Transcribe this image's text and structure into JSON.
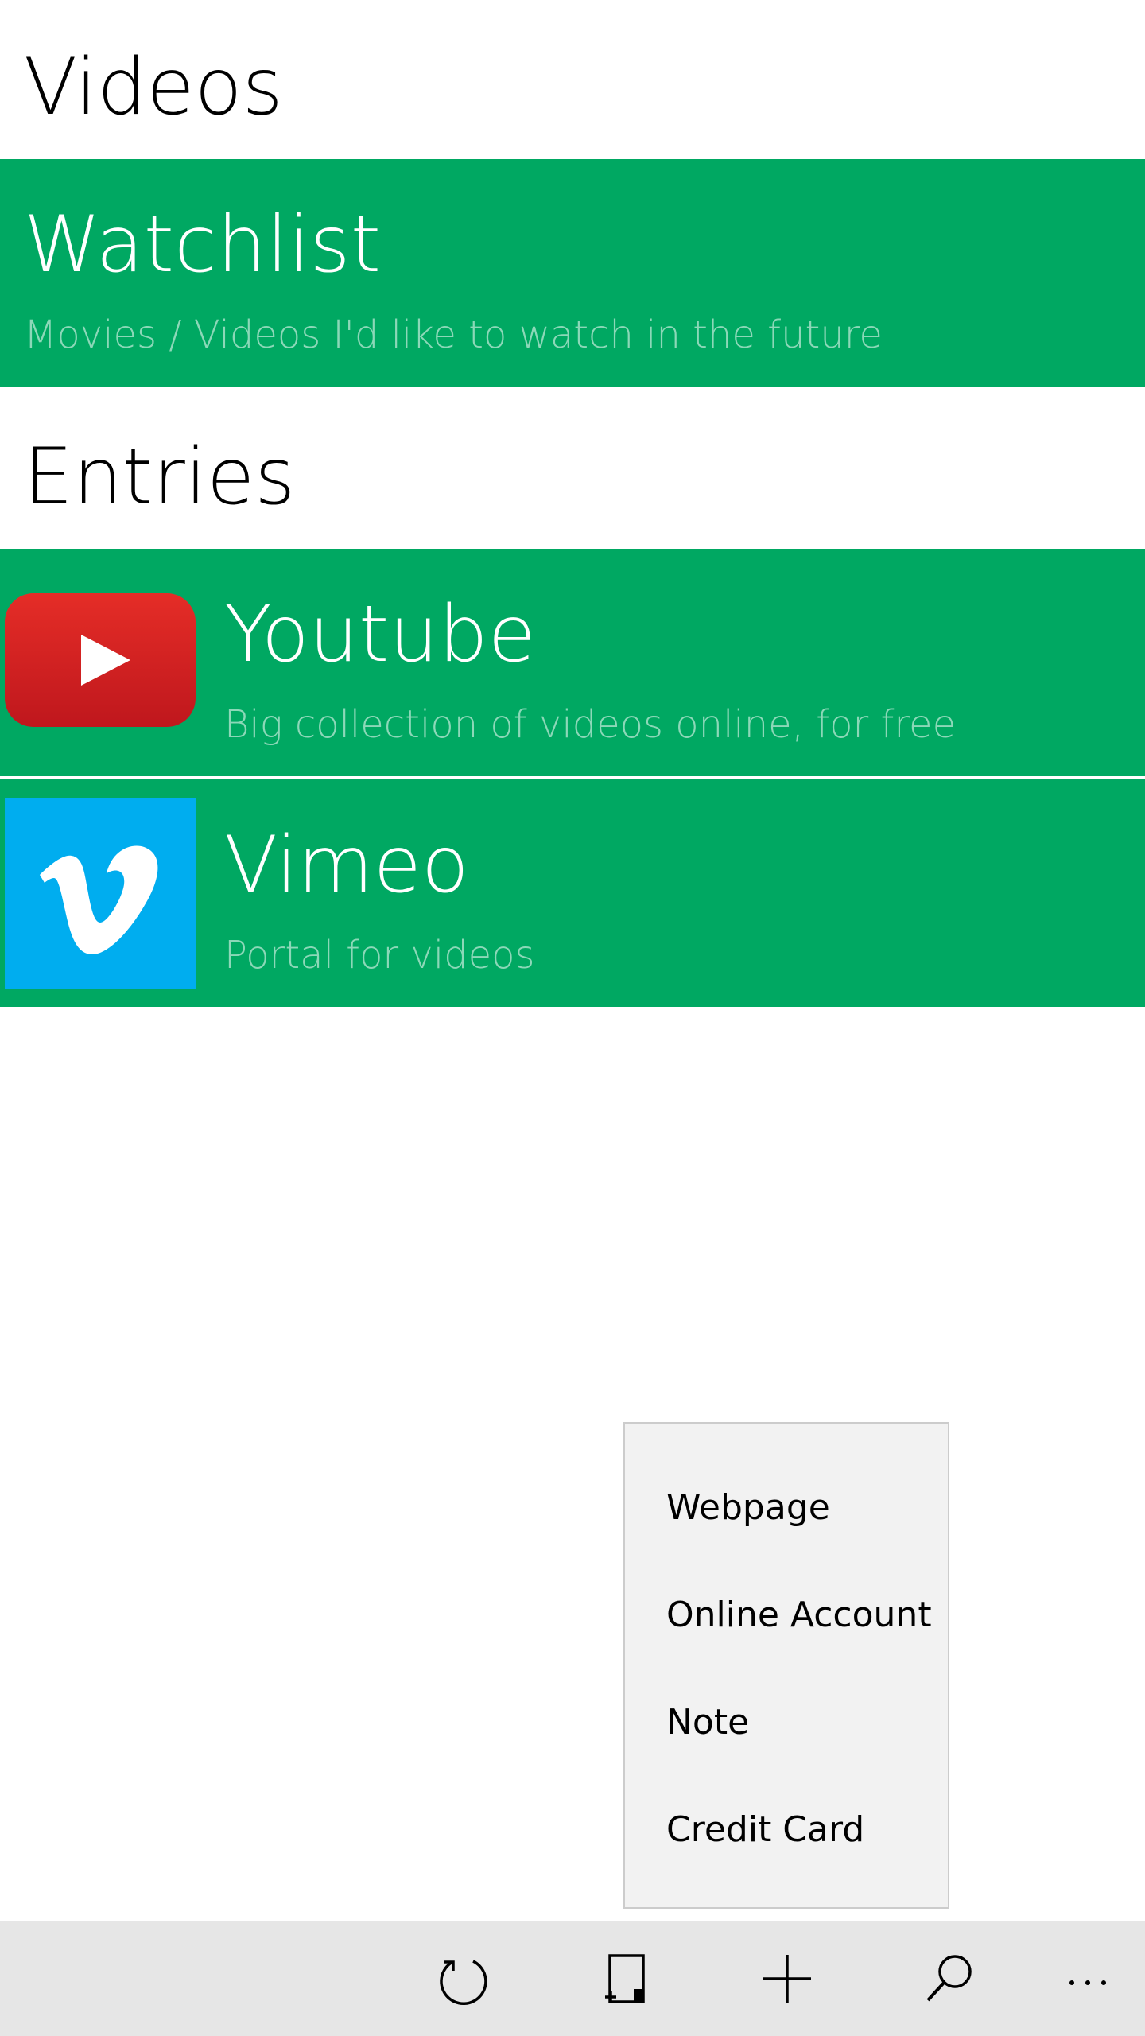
{
  "header": {
    "title": "Videos"
  },
  "group": {
    "title": "Watchlist",
    "subtitle": "Movies / Videos I'd like to watch in the future"
  },
  "section": {
    "title": "Entries"
  },
  "entries": [
    {
      "title": "Youtube",
      "subtitle": "Big collection of videos online, for free",
      "icon": "youtube-logo-icon"
    },
    {
      "title": "Vimeo",
      "subtitle": "Portal for videos",
      "icon": "vimeo-logo-icon"
    }
  ],
  "add_menu": {
    "items": [
      {
        "label": "Webpage"
      },
      {
        "label": "Online Account"
      },
      {
        "label": "Note"
      },
      {
        "label": "Credit Card"
      }
    ]
  },
  "app_bar": {
    "buttons": [
      {
        "icon": "refresh-icon"
      },
      {
        "icon": "pin-icon"
      },
      {
        "icon": "add-icon"
      },
      {
        "icon": "search-icon"
      },
      {
        "icon": "more-icon"
      }
    ]
  },
  "colors": {
    "accent": "#00a862",
    "youtube_red": "#e52d27",
    "vimeo_blue": "#00adef",
    "app_bar_bg": "#e6e6e6",
    "menu_bg": "#f2f2f2"
  }
}
